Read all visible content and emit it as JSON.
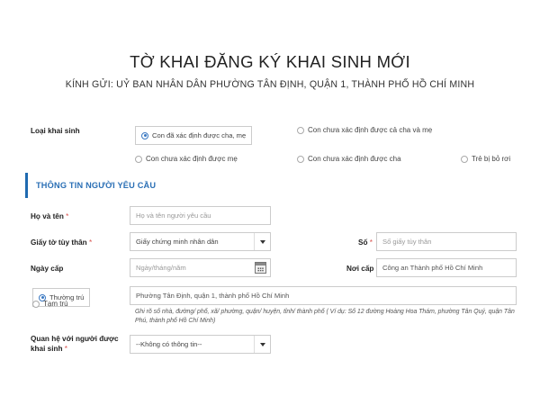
{
  "header": {
    "title": "TỜ KHAI ĐĂNG KÝ KHAI SINH MỚI",
    "subtitle": "KÍNH GỬI: UỶ BAN NHÂN DÂN PHƯỜNG TÂN ĐỊNH, QUẬN 1, THÀNH PHỐ HỒ CHÍ MINH"
  },
  "birth_type": {
    "label": "Loại khai sinh",
    "options": [
      {
        "label": "Con đã xác định được cha, mẹ",
        "selected": true
      },
      {
        "label": "Con chưa xác định được cả cha và mẹ",
        "selected": false
      },
      {
        "label": "Con chưa xác định được mẹ",
        "selected": false
      },
      {
        "label": "Con chưa xác định được cha",
        "selected": false
      },
      {
        "label": "Trẻ bị bỏ rơi",
        "selected": false
      }
    ]
  },
  "section": {
    "title": "THÔNG TIN NGƯỜI YÊU CẦU"
  },
  "form": {
    "required_mark": "*",
    "full_name": {
      "label": "Họ và tên",
      "placeholder": "Họ và tên người yêu cầu"
    },
    "id_doc": {
      "label": "Giấy tờ tùy thân",
      "value": "Giấy chứng minh nhân dân"
    },
    "id_number": {
      "label": "Số",
      "placeholder": "Số giấy tùy thân"
    },
    "issue_date": {
      "label": "Ngày cấp",
      "placeholder": "Ngày/tháng/năm"
    },
    "issue_place": {
      "label": "Nơi cấp",
      "value": "Công an Thành phố Hồ Chí Minh"
    },
    "residence": {
      "options": [
        {
          "label": "Thường trú",
          "selected": true
        },
        {
          "label": "Tạm trú",
          "selected": false
        }
      ],
      "value": "Phường Tân Định, quận 1, thành phố Hồ Chí Minh",
      "hint": "Ghi rõ số nhà, đường/ phố, xã/ phường, quận/ huyện, tỉnh/ thành phố ( Ví dụ: Số 12 đường Hoàng Hoa Thám, phường Tân Quý, quận Tân Phú, thành phố Hồ Chí Minh)"
    },
    "relationship": {
      "label_line1": "Quan hệ với người được",
      "label_line2": "khai sinh",
      "value": "--Không có thông tin--"
    }
  },
  "colors": {
    "accent": "#1f6ab0",
    "required": "#d9534f",
    "border": "#cccccc"
  }
}
